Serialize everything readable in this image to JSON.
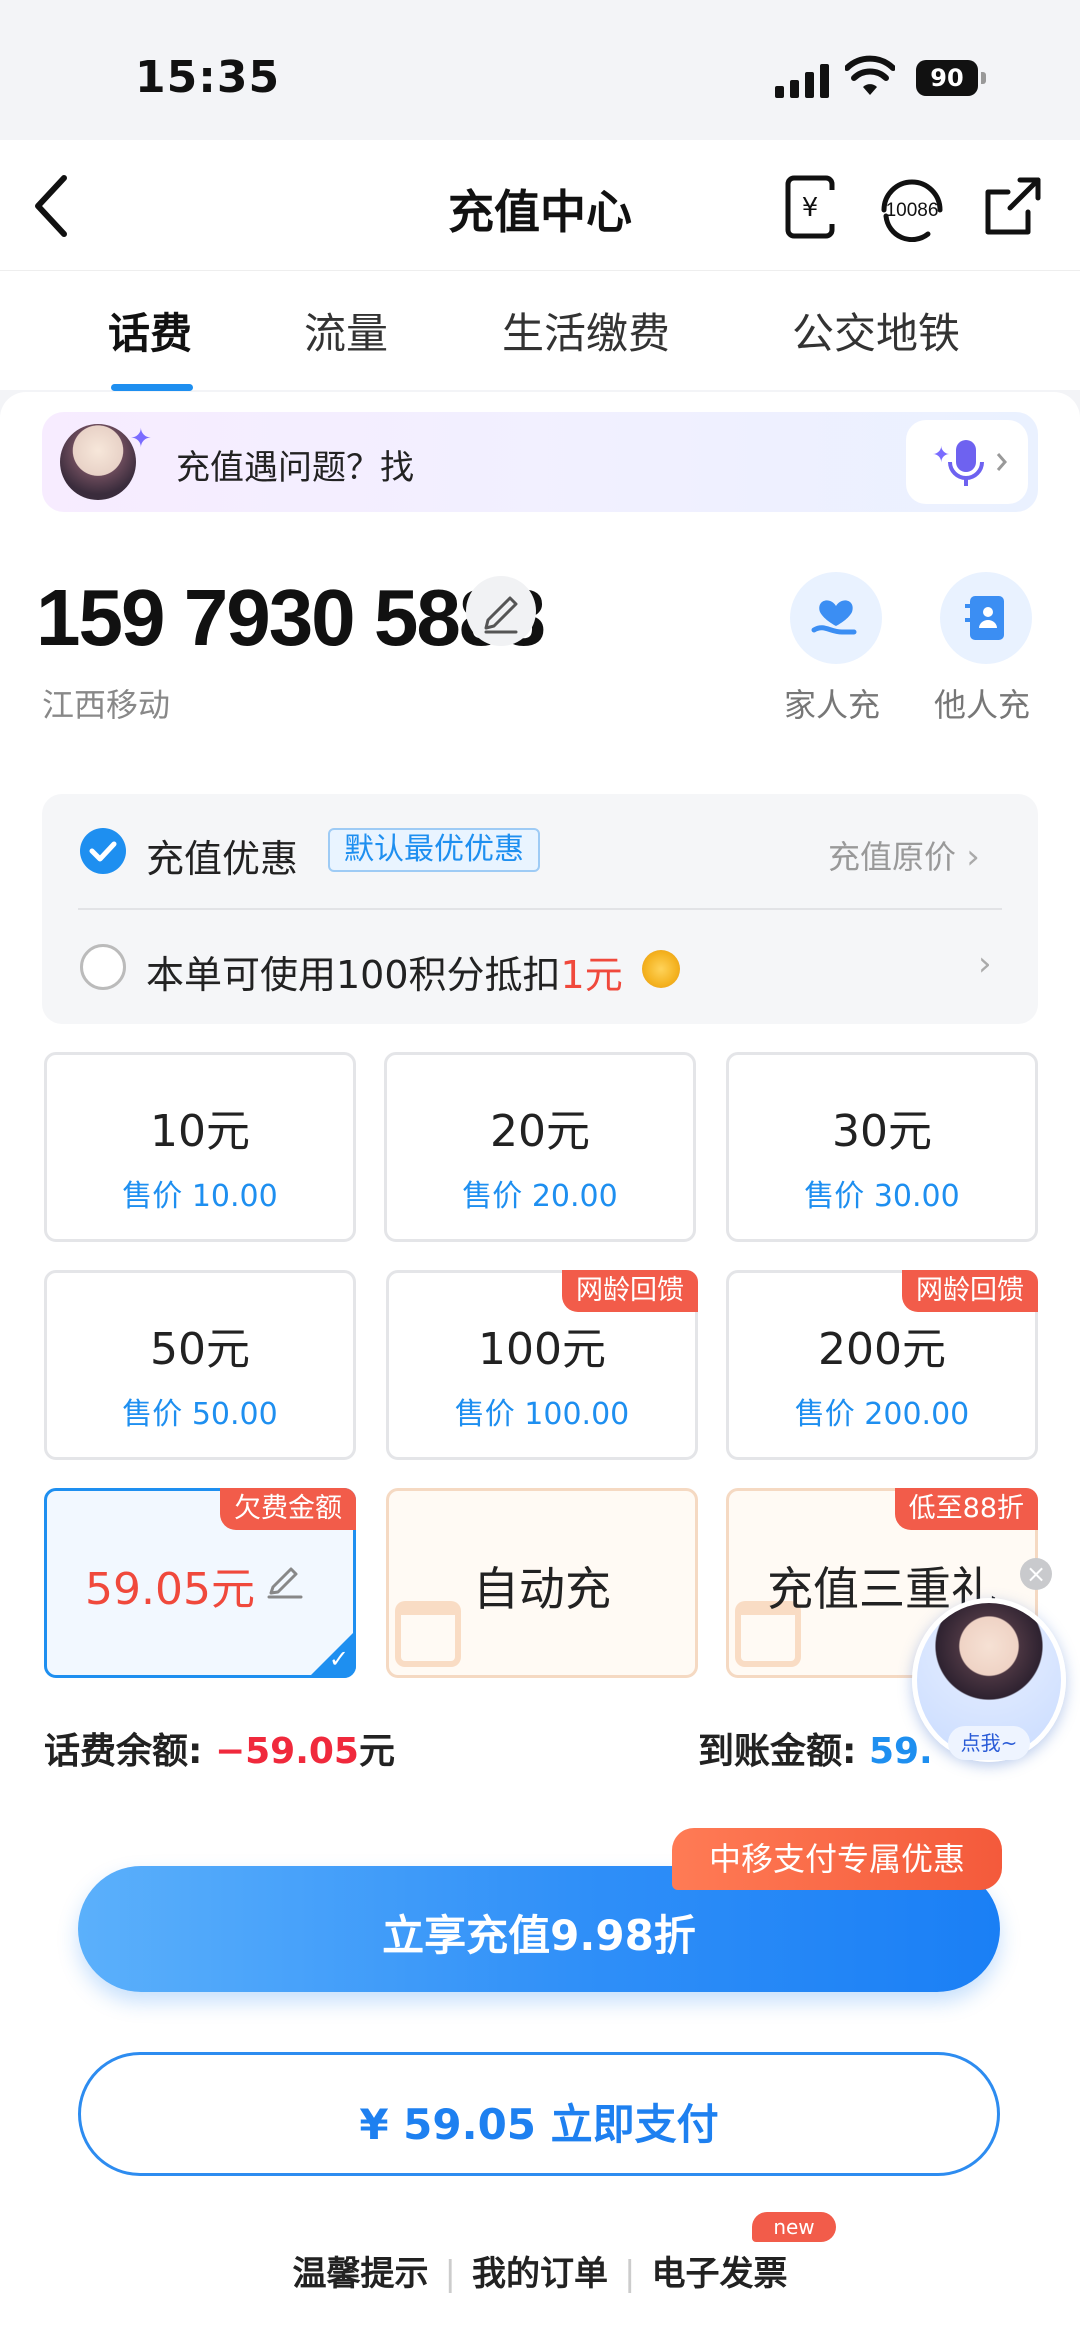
{
  "status_bar": {
    "time": "15:35",
    "battery": "90"
  },
  "header": {
    "title": "充值中心",
    "phone_code": "10086"
  },
  "tabs": [
    {
      "label": "话费",
      "active": true
    },
    {
      "label": "流量",
      "active": false
    },
    {
      "label": "生活缴费",
      "active": false
    },
    {
      "label": "公交地铁",
      "active": false
    }
  ],
  "help_banner": {
    "text": "充值遇问题？找"
  },
  "account": {
    "phone": "159 7930 5888",
    "carrier": "江西移动",
    "quick_actions": [
      {
        "label": "家人充"
      },
      {
        "label": "他人充"
      }
    ]
  },
  "discount": {
    "title": "充值优惠",
    "badge": "默认最优优惠",
    "original_price": "充值原价",
    "points_text": "本单可使用100积分抵扣",
    "points_amount": "1元"
  },
  "amounts": [
    {
      "main": "10元",
      "sub": "售价 10.00"
    },
    {
      "main": "20元",
      "sub": "售价 20.00"
    },
    {
      "main": "30元",
      "sub": "售价 30.00"
    },
    {
      "main": "50元",
      "sub": "售价 50.00"
    },
    {
      "main": "100元",
      "sub": "售价 100.00",
      "tag": "网龄回馈"
    },
    {
      "main": "200元",
      "sub": "售价 200.00",
      "tag": "网龄回馈"
    }
  ],
  "special_cards": {
    "arrears": {
      "tag": "欠费金额",
      "value": "59.05元"
    },
    "auto": {
      "label": "自动充"
    },
    "gift": {
      "label": "充值三重礼",
      "tag": "低至88折"
    }
  },
  "balance": {
    "label": "话费余额: ",
    "value": "−59.05",
    "unit": "元",
    "arrival_label": "到账金额: ",
    "arrival_value": "59."
  },
  "assistant": {
    "label": "点我~"
  },
  "promo": {
    "tag": "中移支付专属优惠"
  },
  "buttons": {
    "primary": "立享充值9.98折",
    "pay": "¥ 59.05  立即支付"
  },
  "footer": {
    "links": [
      "温馨提示",
      "我的订单",
      "电子发票"
    ],
    "new_badge": "new"
  },
  "colors": {
    "accent": "#1e8ff0",
    "warning": "#f0493c"
  }
}
